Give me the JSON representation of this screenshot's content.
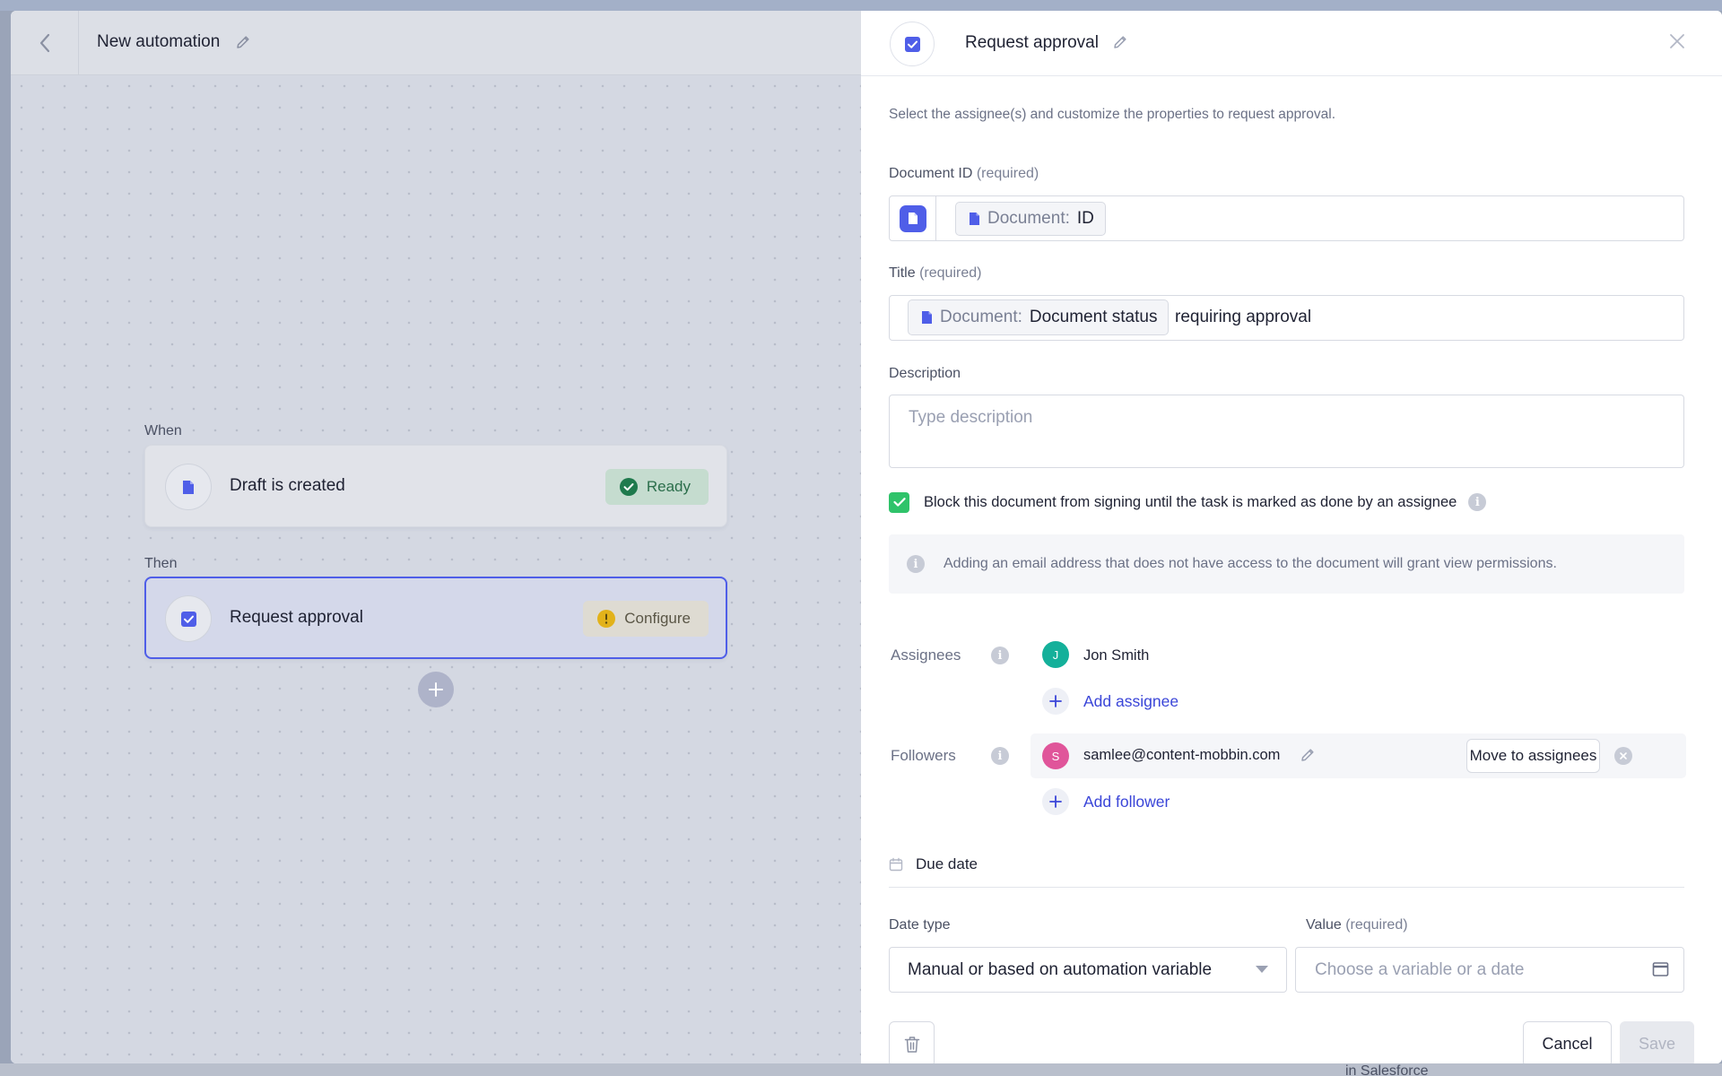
{
  "canvas": {
    "back_icon": "chevron-left-icon",
    "title": "New automation",
    "when_label": "When",
    "then_label": "Then",
    "trigger": {
      "label": "Draft is created",
      "status": "Ready",
      "icon": "document-icon",
      "status_icon": "check-circle-icon"
    },
    "action": {
      "label": "Request approval",
      "status": "Configure",
      "icon": "checkbox-icon",
      "status_icon": "warning-icon"
    },
    "add_step_icon": "plus-icon"
  },
  "panel": {
    "title": "Request approval",
    "hint": "Select the assignee(s) and customize the properties to request approval.",
    "document_id": {
      "label": "Document ID",
      "required": "(required)",
      "chip_key": "Document:",
      "chip_value": "ID"
    },
    "title_field": {
      "label": "Title",
      "required": "(required)",
      "chip_key": "Document:",
      "chip_value": "Document status",
      "suffix": "requiring approval"
    },
    "description": {
      "label": "Description",
      "placeholder": "Type description"
    },
    "block_checkbox": {
      "checked": true,
      "label": "Block this document from signing until the task is marked as done by an assignee"
    },
    "notice": "Adding an email address that does not have access to the document will grant view permissions.",
    "assignees": {
      "label": "Assignees",
      "people": [
        {
          "initial": "J",
          "name": "Jon Smith",
          "color": "#14b09a"
        }
      ],
      "add_label": "Add assignee"
    },
    "followers": {
      "label": "Followers",
      "people": [
        {
          "initial": "S",
          "name": "samlee@content-mobbin.com",
          "color": "#e0559a"
        }
      ],
      "move_label": "Move to assignees",
      "add_label": "Add follower"
    },
    "due_date": {
      "label": "Due date",
      "date_type_label": "Date type",
      "date_type_value": "Manual or based on automation variable",
      "value_label": "Value",
      "value_required": "(required)",
      "value_placeholder": "Choose a variable or a date"
    },
    "footer": {
      "cancel": "Cancel",
      "save": "Save"
    }
  },
  "background": {
    "partial_text": "in Salesforce"
  },
  "colors": {
    "accent": "#4f5ee8",
    "link": "#3a45d8",
    "success": "#2fc36a",
    "warning": "#e2b21a"
  }
}
